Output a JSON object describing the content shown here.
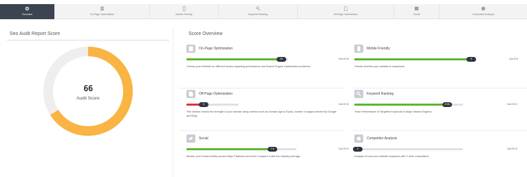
{
  "nav": {
    "items": [
      {
        "label": "Overview",
        "icon": "gauge-icon",
        "active": true
      },
      {
        "label": "On-Page Optimization",
        "icon": "document-icon",
        "active": false
      },
      {
        "label": "Mobile Friendly",
        "icon": "mobile-icon",
        "active": false
      },
      {
        "label": "Keyword Ranking",
        "icon": "key-icon",
        "active": false
      },
      {
        "label": "Off-Page Optimization",
        "icon": "file-icon",
        "active": false
      },
      {
        "label": "Social",
        "icon": "social-icon",
        "active": false
      },
      {
        "label": "Competitor Analysis",
        "icon": "globe-icon",
        "active": false
      }
    ]
  },
  "left": {
    "title": "Seo Audit Report Score",
    "score": "66",
    "score_fraction": 0.66,
    "score_label": "Audit Score"
  },
  "right": {
    "title": "Score Overview",
    "cards": [
      {
        "title": "On-Page Optimization",
        "value": "28",
        "fraction": 0.93,
        "out_of": "Out Of 30",
        "bar_color": "#5cb531",
        "icon": "document-icon",
        "description": "Checks your Website for different issues impacting performance and Search Engine Optimization problems."
      },
      {
        "title": "Mobile Friendly",
        "value": "5",
        "fraction": 1.0,
        "out_of": "Out Of 5",
        "bar_color": "#5cb531",
        "icon": "mobile-icon",
        "description": "Checks whether your website is responsive."
      },
      {
        "title": "Off-Page Optimization",
        "value": "5",
        "fraction": 0.33,
        "out_of": "Out Of 15",
        "bar_color": "#d9363e",
        "icon": "file-icon",
        "description": "This section checks the strength of your domain using metrics such as Domain Age & Expiry, number of pages indexed by Google and Bing."
      },
      {
        "title": "Keyword Ranking",
        "value": "8.55",
        "fraction": 0.855,
        "out_of": "Out Of 10",
        "bar_color": "#5cb531",
        "icon": "key-icon",
        "description": "Track Performance of Targeted Keywords in Major Search Engines."
      },
      {
        "title": "Social",
        "value": "7.8",
        "fraction": 0.78,
        "out_of": "Out Of 10",
        "bar_color": "#5cb531",
        "icon": "social-icon",
        "description": "Monitor your Social Activity across Major Platforms and even Compare it with the Industry average."
      },
      {
        "title": "Competitor Analysis",
        "value": "0",
        "fraction": 0.0,
        "out_of": "Out Of 10",
        "bar_color": "#5cb531",
        "icon": "globe-icon",
        "description": "Analysis of how your website compares with 3 other competitors."
      }
    ]
  },
  "colors": {
    "gauge_fill": "#f9b443",
    "gauge_track": "#eeeeee",
    "nav_active": "#3c4450"
  }
}
